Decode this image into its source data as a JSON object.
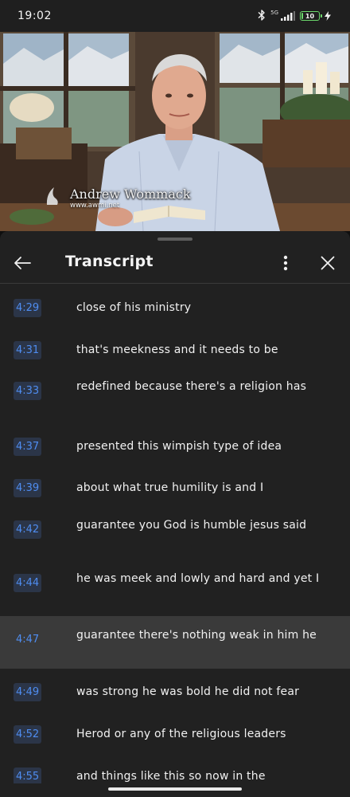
{
  "status_bar": {
    "time": "19:02",
    "network_label": "5G",
    "battery_text": "10",
    "battery_level_percent": 10
  },
  "video": {
    "caption_name": "Andrew Wommack",
    "caption_url": "www.awmi.net"
  },
  "panel": {
    "title": "Transcript"
  },
  "transcript": [
    {
      "time": "4:29",
      "text": "close of his ministry"
    },
    {
      "time": "4:31",
      "text": "that's meekness and it needs to be"
    },
    {
      "time": "4:33",
      "text": "redefined because there's a religion has"
    },
    {
      "time": "4:37",
      "text": "presented this wimpish type of idea"
    },
    {
      "time": "4:39",
      "text": "about what true humility is and I"
    },
    {
      "time": "4:42",
      "text": "guarantee you God is humble jesus said"
    },
    {
      "time": "4:44",
      "text": "he was meek and lowly and hard and yet I"
    },
    {
      "time": "4:47",
      "text": "guarantee there's nothing weak in him he",
      "active": true
    },
    {
      "time": "4:49",
      "text": "was strong he was bold he did not fear"
    },
    {
      "time": "4:52",
      "text": "Herod or any of the religious leaders"
    },
    {
      "time": "4:55",
      "text": "and things like this so now in the"
    }
  ]
}
